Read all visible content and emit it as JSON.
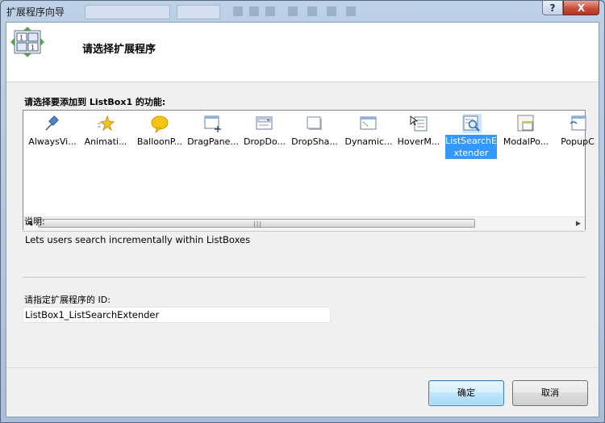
{
  "window": {
    "title": "扩展程序向导",
    "help_glyph": "?",
    "close_glyph": "X"
  },
  "header": {
    "title": "请选择扩展程序"
  },
  "list": {
    "label": "请选择要添加到 ListBox1 的功能:",
    "items": [
      {
        "label": "AlwaysVi...",
        "icon": "pin-icon"
      },
      {
        "label": "Animati...",
        "icon": "sparkle-icon"
      },
      {
        "label": "BalloonP...",
        "icon": "balloon-icon"
      },
      {
        "label": "DragPane...",
        "icon": "drag-panel-icon"
      },
      {
        "label": "DropDo...",
        "icon": "dropdown-icon"
      },
      {
        "label": "DropSha...",
        "icon": "drop-shadow-icon"
      },
      {
        "label": "Dynamic...",
        "icon": "dynamic-populate-icon"
      },
      {
        "label": "HoverM...",
        "icon": "hover-menu-icon"
      },
      {
        "label": "ListSearchExtender",
        "icon": "list-search-icon",
        "selected": true
      },
      {
        "label": "ModalPo...",
        "icon": "modal-popup-icon"
      },
      {
        "label": "PopupC",
        "icon": "popup-control-icon"
      }
    ],
    "scroll_left": "◀",
    "scroll_right": "▶",
    "grip": "|||"
  },
  "description": {
    "label": "说明:",
    "text": "Lets users search incrementally within ListBoxes"
  },
  "id_field": {
    "label": "请指定扩展程序的 ID:",
    "value": "ListBox1_ListSearchExtender"
  },
  "buttons": {
    "ok": "确定",
    "cancel": "取消"
  },
  "colors": {
    "selection": "#3399ff",
    "close_button": "#c7503d"
  }
}
